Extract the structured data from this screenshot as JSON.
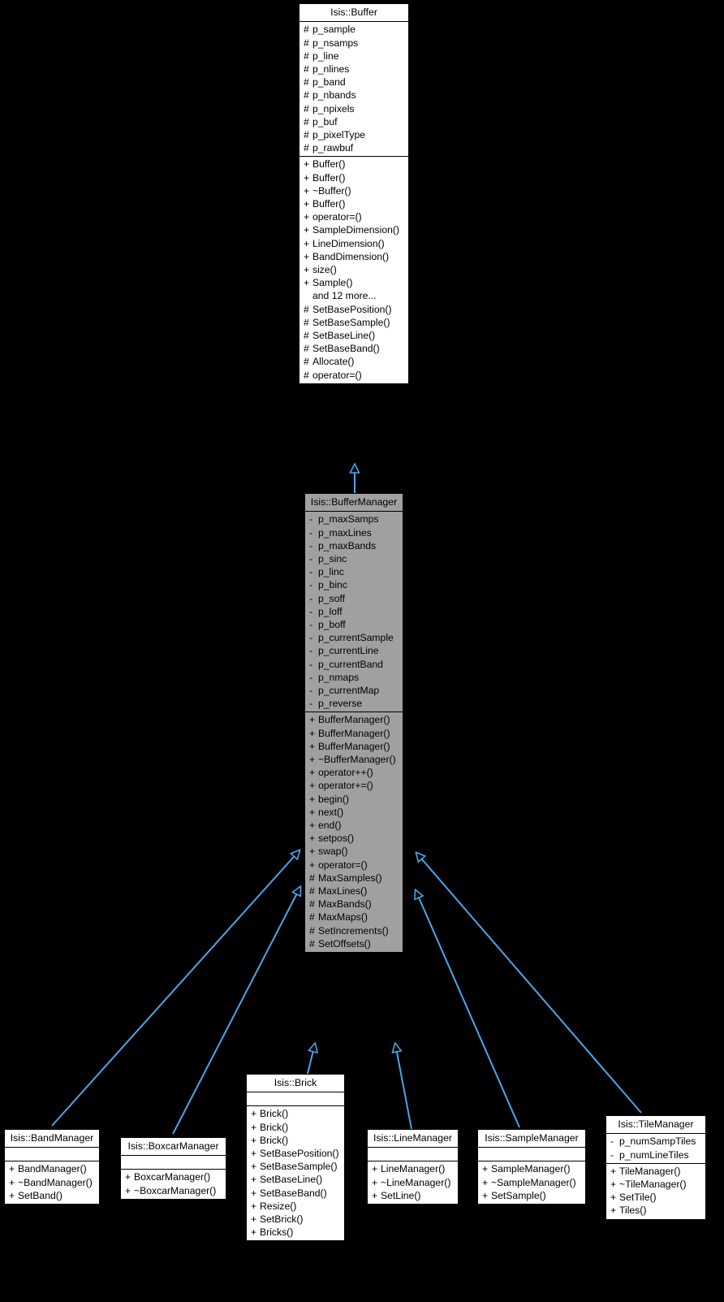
{
  "diagram": {
    "type": "uml-class-inheritance",
    "background_color": "#000000",
    "edge_color": "#4ba6e8",
    "highlight_color": "#a0a0a0",
    "box_fill": "#ffffff",
    "box_border": "#000000"
  },
  "classes": [
    {
      "id": "buffer",
      "name": "Isis::Buffer",
      "highlighted": false,
      "attributes": [
        {
          "vis": "#",
          "label": "p_sample"
        },
        {
          "vis": "#",
          "label": "p_nsamps"
        },
        {
          "vis": "#",
          "label": "p_line"
        },
        {
          "vis": "#",
          "label": "p_nlines"
        },
        {
          "vis": "#",
          "label": "p_band"
        },
        {
          "vis": "#",
          "label": "p_nbands"
        },
        {
          "vis": "#",
          "label": "p_npixels"
        },
        {
          "vis": "#",
          "label": "p_buf"
        },
        {
          "vis": "#",
          "label": "p_pixelType"
        },
        {
          "vis": "#",
          "label": "p_rawbuf"
        }
      ],
      "methods": [
        {
          "vis": "+",
          "label": "Buffer()"
        },
        {
          "vis": "+",
          "label": "Buffer()"
        },
        {
          "vis": "+",
          "label": "~Buffer()"
        },
        {
          "vis": "+",
          "label": "Buffer()"
        },
        {
          "vis": "+",
          "label": "operator=()"
        },
        {
          "vis": "+",
          "label": "SampleDimension()"
        },
        {
          "vis": "+",
          "label": "LineDimension()"
        },
        {
          "vis": "+",
          "label": "BandDimension()"
        },
        {
          "vis": "+",
          "label": "size()"
        },
        {
          "vis": "+",
          "label": "Sample()"
        },
        {
          "vis": "",
          "label": "and 12 more..."
        },
        {
          "vis": "#",
          "label": "SetBasePosition()"
        },
        {
          "vis": "#",
          "label": "SetBaseSample()"
        },
        {
          "vis": "#",
          "label": "SetBaseLine()"
        },
        {
          "vis": "#",
          "label": "SetBaseBand()"
        },
        {
          "vis": "#",
          "label": "Allocate()"
        },
        {
          "vis": "#",
          "label": "operator=()"
        }
      ]
    },
    {
      "id": "buffermanager",
      "name": "Isis::BufferManager",
      "highlighted": true,
      "attributes": [
        {
          "vis": "-",
          "label": "p_maxSamps"
        },
        {
          "vis": "-",
          "label": "p_maxLines"
        },
        {
          "vis": "-",
          "label": "p_maxBands"
        },
        {
          "vis": "-",
          "label": "p_sinc"
        },
        {
          "vis": "-",
          "label": "p_linc"
        },
        {
          "vis": "-",
          "label": "p_binc"
        },
        {
          "vis": "-",
          "label": "p_soff"
        },
        {
          "vis": "-",
          "label": "p_loff"
        },
        {
          "vis": "-",
          "label": "p_boff"
        },
        {
          "vis": "-",
          "label": "p_currentSample"
        },
        {
          "vis": "-",
          "label": "p_currentLine"
        },
        {
          "vis": "-",
          "label": "p_currentBand"
        },
        {
          "vis": "-",
          "label": "p_nmaps"
        },
        {
          "vis": "-",
          "label": "p_currentMap"
        },
        {
          "vis": "-",
          "label": "p_reverse"
        }
      ],
      "methods": [
        {
          "vis": "+",
          "label": "BufferManager()"
        },
        {
          "vis": "+",
          "label": "BufferManager()"
        },
        {
          "vis": "+",
          "label": "BufferManager()"
        },
        {
          "vis": "+",
          "label": "~BufferManager()"
        },
        {
          "vis": "+",
          "label": "operator++()"
        },
        {
          "vis": "+",
          "label": "operator+=()"
        },
        {
          "vis": "+",
          "label": "begin()"
        },
        {
          "vis": "+",
          "label": "next()"
        },
        {
          "vis": "+",
          "label": "end()"
        },
        {
          "vis": "+",
          "label": "setpos()"
        },
        {
          "vis": "+",
          "label": "swap()"
        },
        {
          "vis": "+",
          "label": "operator=()"
        },
        {
          "vis": "#",
          "label": "MaxSamples()"
        },
        {
          "vis": "#",
          "label": "MaxLines()"
        },
        {
          "vis": "#",
          "label": "MaxBands()"
        },
        {
          "vis": "#",
          "label": "MaxMaps()"
        },
        {
          "vis": "#",
          "label": "SetIncrements()"
        },
        {
          "vis": "#",
          "label": "SetOffsets()"
        }
      ]
    },
    {
      "id": "bandmanager",
      "name": "Isis::BandManager",
      "highlighted": false,
      "attributes": [],
      "methods": [
        {
          "vis": "+",
          "label": "BandManager()"
        },
        {
          "vis": "+",
          "label": "~BandManager()"
        },
        {
          "vis": "+",
          "label": "SetBand()"
        }
      ]
    },
    {
      "id": "boxcarmanager",
      "name": "Isis::BoxcarManager",
      "highlighted": false,
      "attributes": [],
      "methods": [
        {
          "vis": "+",
          "label": "BoxcarManager()"
        },
        {
          "vis": "+",
          "label": "~BoxcarManager()"
        }
      ]
    },
    {
      "id": "brick",
      "name": "Isis::Brick",
      "highlighted": false,
      "attributes": [],
      "methods": [
        {
          "vis": "+",
          "label": "Brick()"
        },
        {
          "vis": "+",
          "label": "Brick()"
        },
        {
          "vis": "+",
          "label": "Brick()"
        },
        {
          "vis": "+",
          "label": "SetBasePosition()"
        },
        {
          "vis": "+",
          "label": "SetBaseSample()"
        },
        {
          "vis": "+",
          "label": "SetBaseLine()"
        },
        {
          "vis": "+",
          "label": "SetBaseBand()"
        },
        {
          "vis": "+",
          "label": "Resize()"
        },
        {
          "vis": "+",
          "label": "SetBrick()"
        },
        {
          "vis": "+",
          "label": "Bricks()"
        }
      ]
    },
    {
      "id": "linemanager",
      "name": "Isis::LineManager",
      "highlighted": false,
      "attributes": [],
      "methods": [
        {
          "vis": "+",
          "label": "LineManager()"
        },
        {
          "vis": "+",
          "label": "~LineManager()"
        },
        {
          "vis": "+",
          "label": "SetLine()"
        }
      ]
    },
    {
      "id": "samplemanager",
      "name": "Isis::SampleManager",
      "highlighted": false,
      "attributes": [],
      "methods": [
        {
          "vis": "+",
          "label": "SampleManager()"
        },
        {
          "vis": "+",
          "label": "~SampleManager()"
        },
        {
          "vis": "+",
          "label": "SetSample()"
        }
      ]
    },
    {
      "id": "tilemanager",
      "name": "Isis::TileManager",
      "highlighted": false,
      "attributes": [
        {
          "vis": "-",
          "label": "p_numSampTiles"
        },
        {
          "vis": "-",
          "label": "p_numLineTiles"
        }
      ],
      "methods": [
        {
          "vis": "+",
          "label": "TileManager()"
        },
        {
          "vis": "+",
          "label": "~TileManager()"
        },
        {
          "vis": "+",
          "label": "SetTile()"
        },
        {
          "vis": "+",
          "label": "Tiles()"
        }
      ]
    }
  ],
  "edges": [
    {
      "from": "buffermanager",
      "to": "buffer"
    },
    {
      "from": "bandmanager",
      "to": "buffermanager"
    },
    {
      "from": "boxcarmanager",
      "to": "buffermanager"
    },
    {
      "from": "brick",
      "to": "buffermanager"
    },
    {
      "from": "linemanager",
      "to": "buffermanager"
    },
    {
      "from": "samplemanager",
      "to": "buffermanager"
    },
    {
      "from": "tilemanager",
      "to": "buffermanager"
    }
  ]
}
